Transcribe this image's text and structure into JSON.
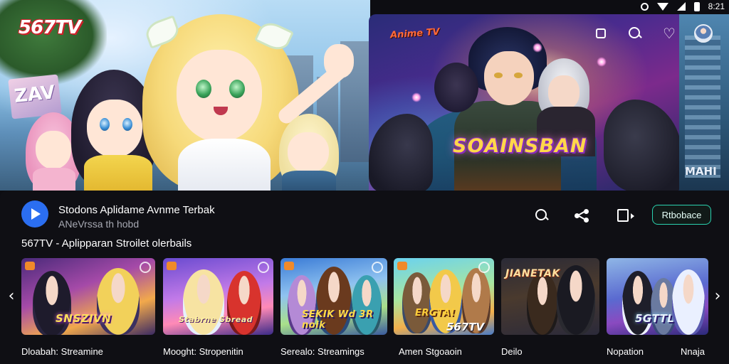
{
  "status_bar": {
    "time": "8:21"
  },
  "hero": {
    "brand_logo": "567TV",
    "billboard_text": "ZAV",
    "featured": {
      "logo": "Anime TV",
      "title": "SOAINSBAN",
      "corner_logo": "MAHI"
    }
  },
  "top_actions": {
    "icons": [
      "cast-icon",
      "search-icon",
      "heart-icon",
      "profile-avatar"
    ]
  },
  "app_info": {
    "title": "Stodons Aplidame Avnme Terbak",
    "subtitle": "ANeVrssa th hobd",
    "action_icons": [
      "search-icon",
      "share-icon",
      "save-icon"
    ],
    "cta_label": "Rtbobace"
  },
  "section": {
    "heading": "567TV - Aplipparan Stroilet olerbails"
  },
  "carousel": {
    "prev_icon": "chevron-left-icon",
    "next_icon": "chevron-right-icon",
    "cards": [
      {
        "overlay": "SNSZIVN",
        "label": "Dloabah: Streamine"
      },
      {
        "overlay": "Stabrne Sbread",
        "label": "Mooght: Stropenitin"
      },
      {
        "overlay": "SEKIK Wd 3R noik",
        "label": "Serealo: Streamings"
      },
      {
        "overlay": "ERGTA!",
        "overlay2": "567TV",
        "label": "Amen Stgoaoin"
      },
      {
        "overlay": "JIANETAK",
        "label": "Deilo"
      },
      {
        "overlay": "5GTTL",
        "label": "Nopation"
      }
    ],
    "peek_label": "Nnaja"
  },
  "colors": {
    "accent": "#2ad3b0",
    "app_icon": "#2b6ef0",
    "brand_red": "#d0202a",
    "panel_bg": "#0f0f14"
  }
}
